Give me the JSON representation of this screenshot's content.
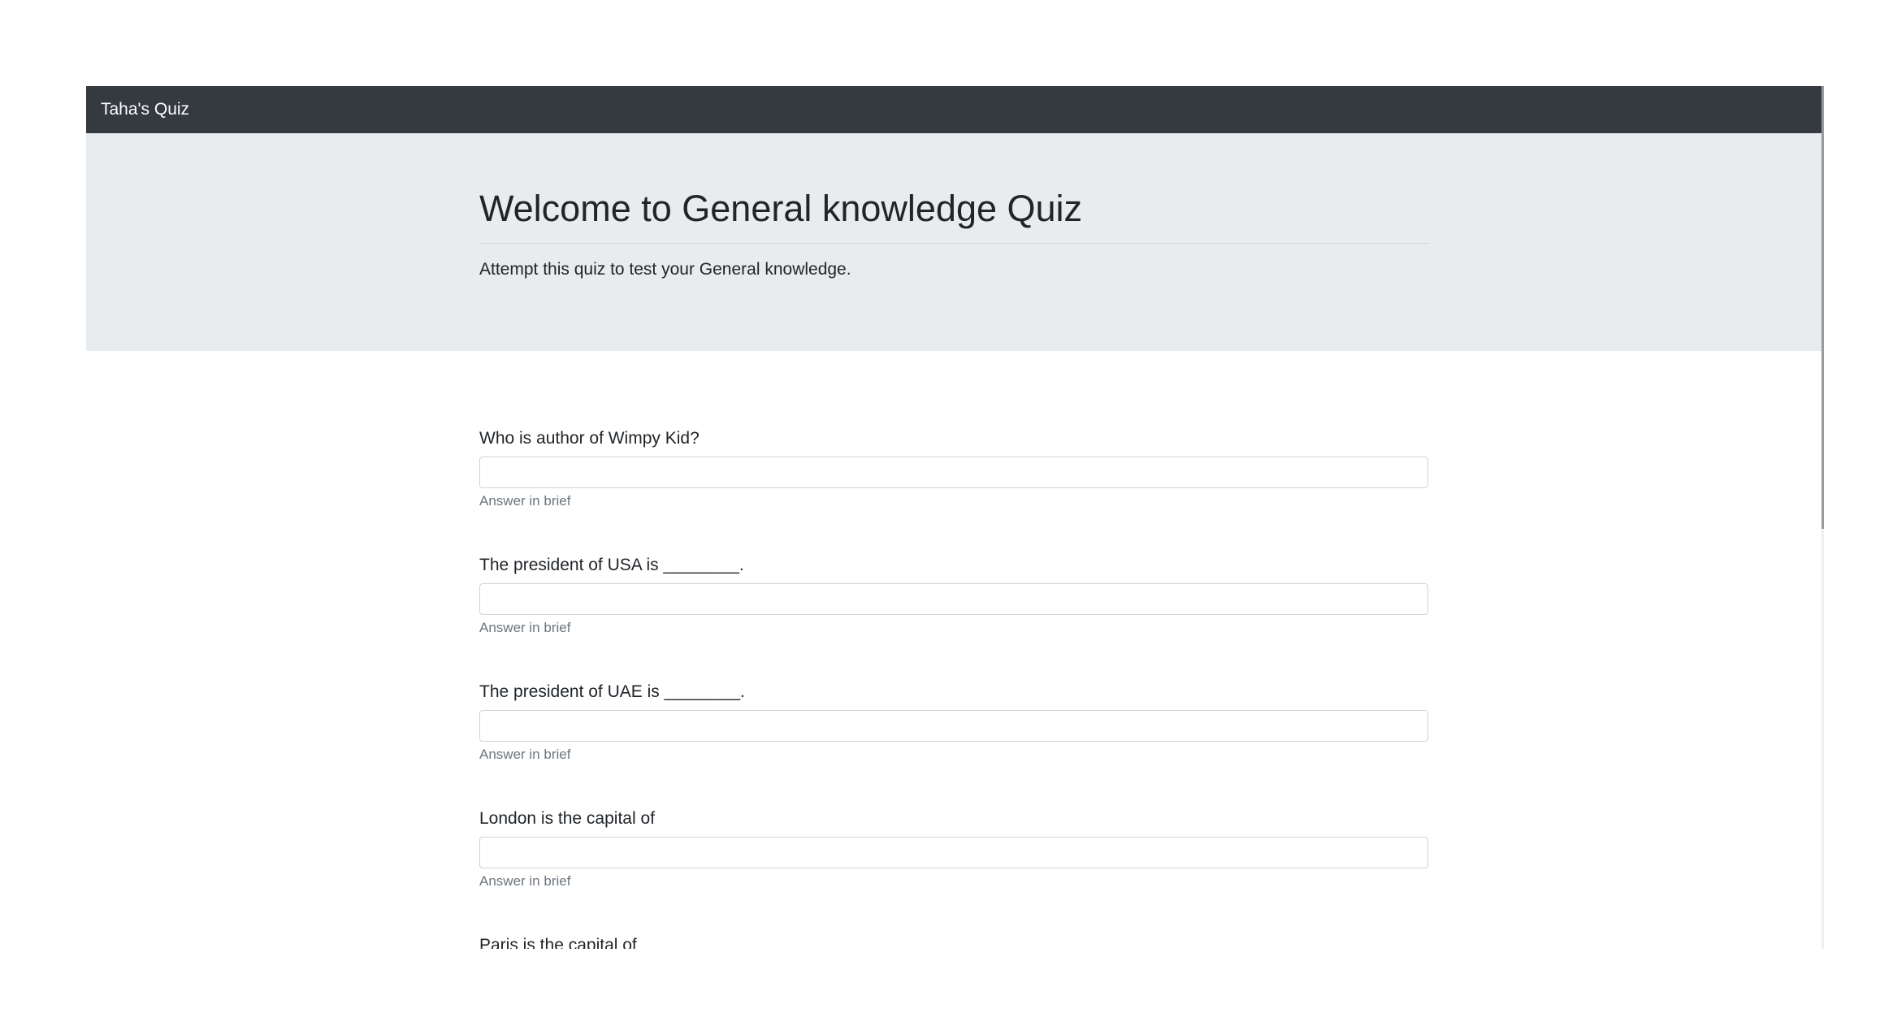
{
  "navbar": {
    "brand": "Taha's Quiz"
  },
  "jumbotron": {
    "title": "Welcome to General knowledge Quiz",
    "lead": "Attempt this quiz to test your General knowledge."
  },
  "questions": [
    {
      "label": "Who is author of Wimpy Kid?",
      "value": "",
      "help": "Answer in brief"
    },
    {
      "label": "The president of USA is ________.",
      "value": "",
      "help": "Answer in brief"
    },
    {
      "label": "The president of UAE is ________.",
      "value": "",
      "help": "Answer in brief"
    },
    {
      "label": "London is the capital of",
      "value": "",
      "help": "Answer in brief"
    },
    {
      "label": "Paris is the capital of",
      "value": "",
      "help": ""
    }
  ]
}
